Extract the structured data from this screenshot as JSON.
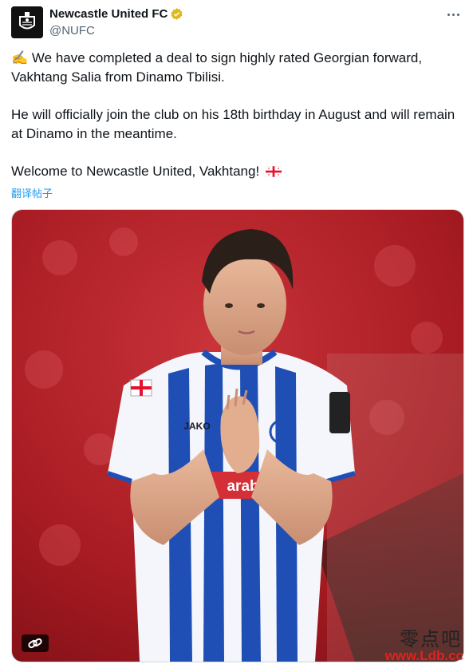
{
  "account": {
    "display_name": "Newcastle United FC",
    "handle": "@NUFC",
    "avatar_icon": "nufc-crest-icon",
    "verified_icon": "gold-verified-badge-icon",
    "verified_color": "#e2b719"
  },
  "menu": {
    "icon": "more-horizontal-icon"
  },
  "tweet": {
    "line1_emoji": "✍️",
    "paragraph1": "We have completed a deal to sign highly rated Georgian forward, Vakhtang Salia from Dinamo Tbilisi.",
    "paragraph2": "He will officially join the club on his 18th birthday in August and will remain at Dinamo in the meantime.",
    "paragraph3": "Welcome to Newcastle United, Vakhtang!",
    "flag_icon": "georgia-flag-icon"
  },
  "translate_label": "翻译帖子",
  "media": {
    "link_icon": "link-icon",
    "shirt_sponsor": "arabet",
    "shirt_brand": "JAKO"
  },
  "watermark": {
    "cn_text": "零点吧",
    "url_text": "www.Ldb.cc"
  },
  "colors": {
    "accent": "#1d9bf0",
    "stadium_red": "#b71c25",
    "kit_blue": "#1f4fb5"
  }
}
